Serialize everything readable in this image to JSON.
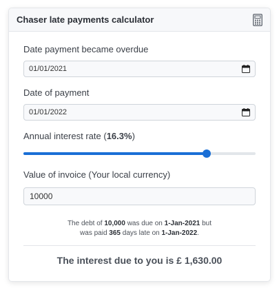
{
  "header": {
    "title": "Chaser late payments calculator",
    "icon": "calculator-icon"
  },
  "overdue": {
    "label": "Date payment became overdue",
    "value": "01/01/2021"
  },
  "payment": {
    "label": "Date of payment",
    "value": "01/01/2022"
  },
  "interest": {
    "label_prefix": "Annual interest rate (",
    "rate_text": "16.3%",
    "label_suffix": ")",
    "slider_fraction": 0.79,
    "accent_color": "#1a6fd6"
  },
  "invoice": {
    "label": "Value of invoice (Your local currency)",
    "value": "10000"
  },
  "summary": {
    "t1": "The debt of ",
    "amount": "10,000",
    "t2": " was due on ",
    "due_date": "1-Jan-2021",
    "t3": " but",
    "t4": "was paid ",
    "days": "365",
    "t5": " days late on ",
    "paid_date": "1-Jan-2022",
    "t6": "."
  },
  "result": {
    "text": "The interest due to you is £ 1,630.00"
  }
}
